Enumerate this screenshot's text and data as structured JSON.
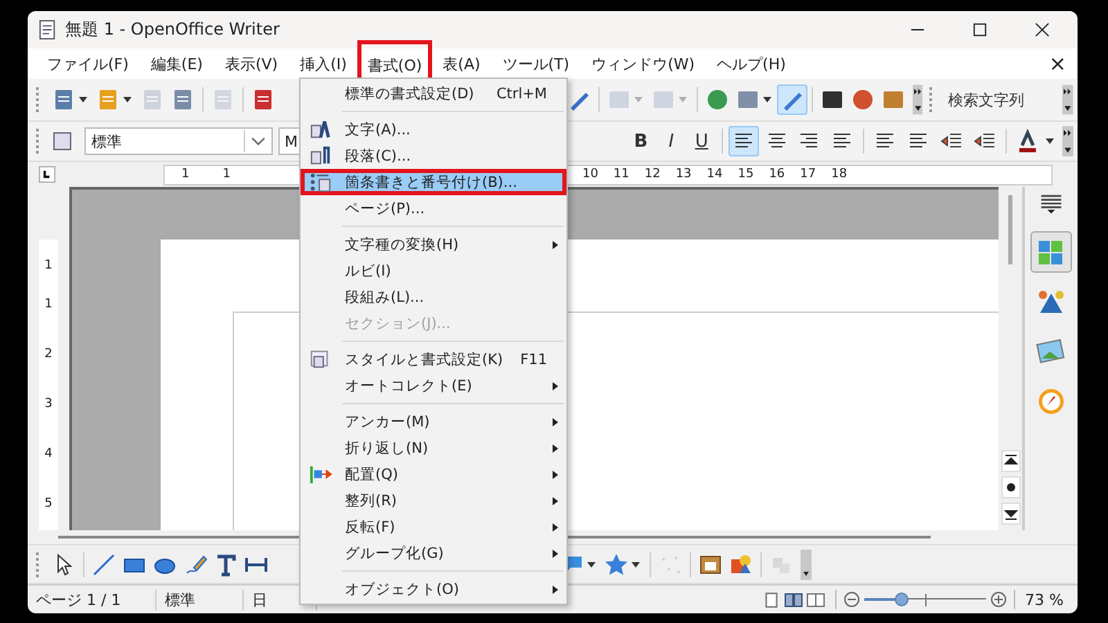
{
  "window": {
    "title": "無題 1 - OpenOffice Writer"
  },
  "menu_bar": {
    "items": [
      {
        "label": "ファイル(F)",
        "selected": false
      },
      {
        "label": "編集(E)",
        "selected": false
      },
      {
        "label": "表示(V)",
        "selected": false
      },
      {
        "label": "挿入(I)",
        "selected": false
      },
      {
        "label": "書式(O)",
        "selected": true
      },
      {
        "label": "表(A)",
        "selected": false
      },
      {
        "label": "ツール(T)",
        "selected": false
      },
      {
        "label": "ウィンドウ(W)",
        "selected": false
      },
      {
        "label": "ヘルプ(H)",
        "selected": false
      }
    ],
    "close_glyph": "×"
  },
  "toolbar_standard": {
    "left": [
      {
        "kind": "new-doc",
        "dropdown": true,
        "disabled": false,
        "selected": false
      },
      {
        "kind": "folder",
        "dropdown": true,
        "disabled": false,
        "selected": false
      },
      {
        "kind": "save",
        "dropdown": false,
        "disabled": true,
        "selected": false
      },
      {
        "kind": "mail",
        "dropdown": false,
        "disabled": false,
        "selected": false
      },
      {
        "kind": "separator"
      },
      {
        "kind": "edit",
        "dropdown": false,
        "disabled": true,
        "selected": false
      },
      {
        "kind": "separator"
      },
      {
        "kind": "pdf",
        "dropdown": false,
        "disabled": false,
        "selected": false
      }
    ],
    "right": [
      {
        "kind": "brush",
        "dropdown": false,
        "disabled": false,
        "selected": false
      },
      {
        "kind": "separator"
      },
      {
        "kind": "undo",
        "dropdown": true,
        "disabled": true,
        "selected": false
      },
      {
        "kind": "redo",
        "dropdown": true,
        "disabled": true,
        "selected": false
      },
      {
        "kind": "separator"
      },
      {
        "kind": "globe",
        "dropdown": false,
        "disabled": false,
        "selected": false
      },
      {
        "kind": "table",
        "dropdown": true,
        "disabled": false,
        "selected": false
      },
      {
        "kind": "pencil",
        "dropdown": false,
        "disabled": false,
        "selected": true
      },
      {
        "kind": "separator"
      },
      {
        "kind": "binoculars",
        "dropdown": false,
        "disabled": false,
        "selected": false
      },
      {
        "kind": "compass",
        "dropdown": false,
        "disabled": false,
        "selected": false
      },
      {
        "kind": "picture",
        "dropdown": false,
        "disabled": false,
        "selected": false
      }
    ],
    "search_placeholder": "検索文字列"
  },
  "toolbar_formatting": {
    "paragraph_style": "標準",
    "font_name": "M",
    "right": [
      {
        "kind": "bold",
        "label": "B",
        "selected": false
      },
      {
        "kind": "italic",
        "label": "I",
        "selected": false
      },
      {
        "kind": "underline",
        "label": "U",
        "selected": false
      },
      {
        "kind": "separator"
      },
      {
        "kind": "align-left",
        "selected": true
      },
      {
        "kind": "align-center",
        "selected": false
      },
      {
        "kind": "align-right",
        "selected": false
      },
      {
        "kind": "justify",
        "selected": false
      },
      {
        "kind": "separator"
      },
      {
        "kind": "numbering",
        "selected": false
      },
      {
        "kind": "bullets",
        "selected": false
      },
      {
        "kind": "outdent",
        "selected": false
      },
      {
        "kind": "indent",
        "selected": false
      },
      {
        "kind": "separator"
      },
      {
        "kind": "font-color",
        "selected": false
      }
    ]
  },
  "ruler": {
    "left_labels": [
      "1",
      "1"
    ],
    "right_labels": [
      "10",
      "11",
      "12",
      "13",
      "14",
      "15",
      "16",
      "17",
      "18"
    ],
    "vertical_labels": [
      "1",
      "1",
      "2",
      "3",
      "4",
      "5"
    ]
  },
  "format_menu": {
    "items": [
      {
        "kind": "item",
        "label": "標準の書式設定(D)",
        "shortcut": "Ctrl+M",
        "has_submenu": false,
        "disabled": false,
        "selected": false
      },
      {
        "kind": "separator"
      },
      {
        "kind": "item",
        "label": "文字(A)...",
        "has_submenu": false,
        "disabled": false,
        "selected": false
      },
      {
        "kind": "item",
        "label": "段落(C)...",
        "has_submenu": false,
        "disabled": false,
        "selected": false
      },
      {
        "kind": "item",
        "label": "箇条書きと番号付け(B)...",
        "has_submenu": false,
        "disabled": false,
        "selected": true
      },
      {
        "kind": "item",
        "label": "ページ(P)...",
        "has_submenu": false,
        "disabled": false,
        "selected": false
      },
      {
        "kind": "separator"
      },
      {
        "kind": "item",
        "label": "文字種の変換(H)",
        "has_submenu": true,
        "disabled": false,
        "selected": false
      },
      {
        "kind": "item",
        "label": "ルビ(I)",
        "has_submenu": false,
        "disabled": false,
        "selected": false
      },
      {
        "kind": "item",
        "label": "段組み(L)...",
        "has_submenu": false,
        "disabled": false,
        "selected": false
      },
      {
        "kind": "item",
        "label": "セクション(J)...",
        "has_submenu": false,
        "disabled": true,
        "selected": false
      },
      {
        "kind": "separator"
      },
      {
        "kind": "item",
        "label": "スタイルと書式設定(K)",
        "shortcut": "F11",
        "has_submenu": false,
        "disabled": false,
        "selected": false
      },
      {
        "kind": "item",
        "label": "オートコレクト(E)",
        "has_submenu": true,
        "disabled": false,
        "selected": false
      },
      {
        "kind": "separator"
      },
      {
        "kind": "item",
        "label": "アンカー(M)",
        "has_submenu": true,
        "disabled": false,
        "selected": false
      },
      {
        "kind": "item",
        "label": "折り返し(N)",
        "has_submenu": true,
        "disabled": false,
        "selected": false
      },
      {
        "kind": "item",
        "label": "配置(Q)",
        "has_submenu": true,
        "disabled": false,
        "selected": false
      },
      {
        "kind": "item",
        "label": "整列(R)",
        "has_submenu": true,
        "disabled": false,
        "selected": false
      },
      {
        "kind": "item",
        "label": "反転(F)",
        "has_submenu": true,
        "disabled": false,
        "selected": false
      },
      {
        "kind": "item",
        "label": "グループ化(G)",
        "has_submenu": true,
        "disabled": false,
        "selected": false
      },
      {
        "kind": "separator"
      },
      {
        "kind": "item",
        "label": "オブジェクト(O)",
        "has_submenu": true,
        "disabled": false,
        "selected": false
      }
    ]
  },
  "drawing_toolbar": {
    "items": [
      {
        "kind": "arrow",
        "dropdown": false,
        "disabled": false
      },
      {
        "kind": "separator"
      },
      {
        "kind": "line",
        "dropdown": false,
        "disabled": false
      },
      {
        "kind": "rect",
        "dropdown": false,
        "disabled": false
      },
      {
        "kind": "ellipse",
        "dropdown": false,
        "disabled": false
      },
      {
        "kind": "freeform",
        "dropdown": false,
        "disabled": false
      },
      {
        "kind": "text",
        "dropdown": false,
        "disabled": false
      },
      {
        "kind": "dimension",
        "dropdown": false,
        "disabled": false
      }
    ],
    "right": [
      {
        "kind": "callout",
        "dropdown": true,
        "disabled": false
      },
      {
        "kind": "star",
        "dropdown": true,
        "disabled": false
      },
      {
        "kind": "separator"
      },
      {
        "kind": "points",
        "dropdown": false,
        "disabled": true
      },
      {
        "kind": "separator"
      },
      {
        "kind": "fontwork",
        "dropdown": false,
        "disabled": false
      },
      {
        "kind": "shapes",
        "dropdown": false,
        "disabled": false
      },
      {
        "kind": "separator"
      },
      {
        "kind": "extrusion",
        "dropdown": false,
        "disabled": true
      }
    ]
  },
  "sidebar": {
    "items": [
      {
        "kind": "properties",
        "selected": true
      },
      {
        "kind": "styles",
        "selected": false
      },
      {
        "kind": "gallery",
        "selected": false
      },
      {
        "kind": "navigator",
        "selected": false
      }
    ]
  },
  "status_bar": {
    "page": "ページ 1 / 1",
    "page_style": "標準",
    "language": "日",
    "zoom_slider": {
      "level": 0.31
    },
    "zoom": "73 %"
  }
}
